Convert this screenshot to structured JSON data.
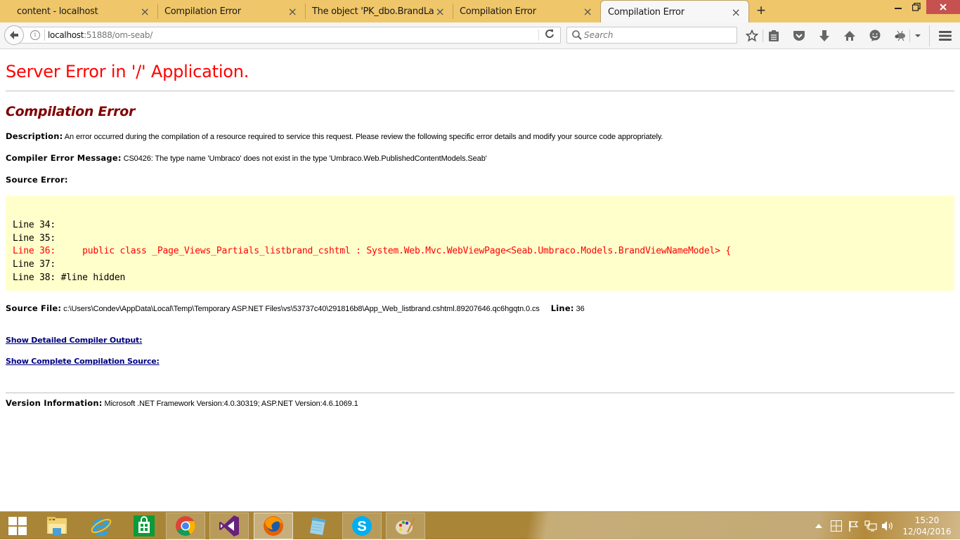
{
  "browser": {
    "tabs": [
      {
        "label": "content - localhost",
        "active": false
      },
      {
        "label": "Compilation Error",
        "active": false
      },
      {
        "label": "The object 'PK_dbo.BrandLan...",
        "active": false
      },
      {
        "label": "Compilation Error",
        "active": false
      },
      {
        "label": "Compilation Error",
        "active": true
      }
    ],
    "new_tab_symbol": "+",
    "url_host": "localhost",
    "url_rest": ":51888/om-seab/",
    "search_placeholder": "Search",
    "toolbar_icons": [
      "bookmark-star-icon",
      "reading-list-icon",
      "pocket-icon",
      "download-icon",
      "home-icon",
      "chat-icon",
      "bug-extension-icon",
      "overflow-dropdown-icon",
      "hamburger-menu-icon"
    ]
  },
  "page": {
    "title": "Server Error in '/' Application.",
    "subtitle": "Compilation Error",
    "description_label": "Description:",
    "description_text": "An error occurred during the compilation of a resource required to service this request. Please review the following specific error details and modify your source code appropriately.",
    "compiler_msg_label": "Compiler Error Message:",
    "compiler_msg_text": "CS0426: The type name 'Umbraco' does not exist in the type 'Umbraco.Web.PublishedContentModels.Seab'",
    "source_error_label": "Source Error:",
    "code_lines": [
      {
        "text": "Line 34:",
        "error": false
      },
      {
        "text": "Line 35:",
        "error": false
      },
      {
        "text": "Line 36:     public class _Page_Views_Partials_listbrand_cshtml : System.Web.Mvc.WebViewPage<Seab.Umbraco.Models.BrandViewNameModel> {",
        "error": true
      },
      {
        "text": "Line 37:",
        "error": false
      },
      {
        "text": "Line 38: #line hidden",
        "error": false
      }
    ],
    "source_file_label": "Source File:",
    "source_file_text": "c:\\Users\\Condev\\AppData\\Local\\Temp\\Temporary ASP.NET Files\\vs\\53737c40\\291816b8\\App_Web_listbrand.cshtml.89207646.qc6hgqtn.0.cs",
    "line_label": "Line:",
    "line_value": "36",
    "link_compiler_output": "Show Detailed Compiler Output:",
    "link_compilation_source": "Show Complete Compilation Source:",
    "version_label": "Version Information:",
    "version_text": "Microsoft .NET Framework Version:4.0.30319; ASP.NET Version:4.6.1069.1"
  },
  "taskbar": {
    "apps": [
      "start",
      "file-explorer",
      "internet-explorer",
      "store",
      "chrome",
      "visual-studio",
      "firefox",
      "notepad",
      "skype",
      "paint"
    ],
    "time": "15:20",
    "date": "12/04/2016"
  },
  "colors": {
    "title_red": "#ff0000",
    "subtitle_maroon": "#800000",
    "code_bg": "#ffffcc",
    "link_navy": "#000080",
    "tabstrip_bg": "#efc66a",
    "close_red": "#c75050"
  }
}
